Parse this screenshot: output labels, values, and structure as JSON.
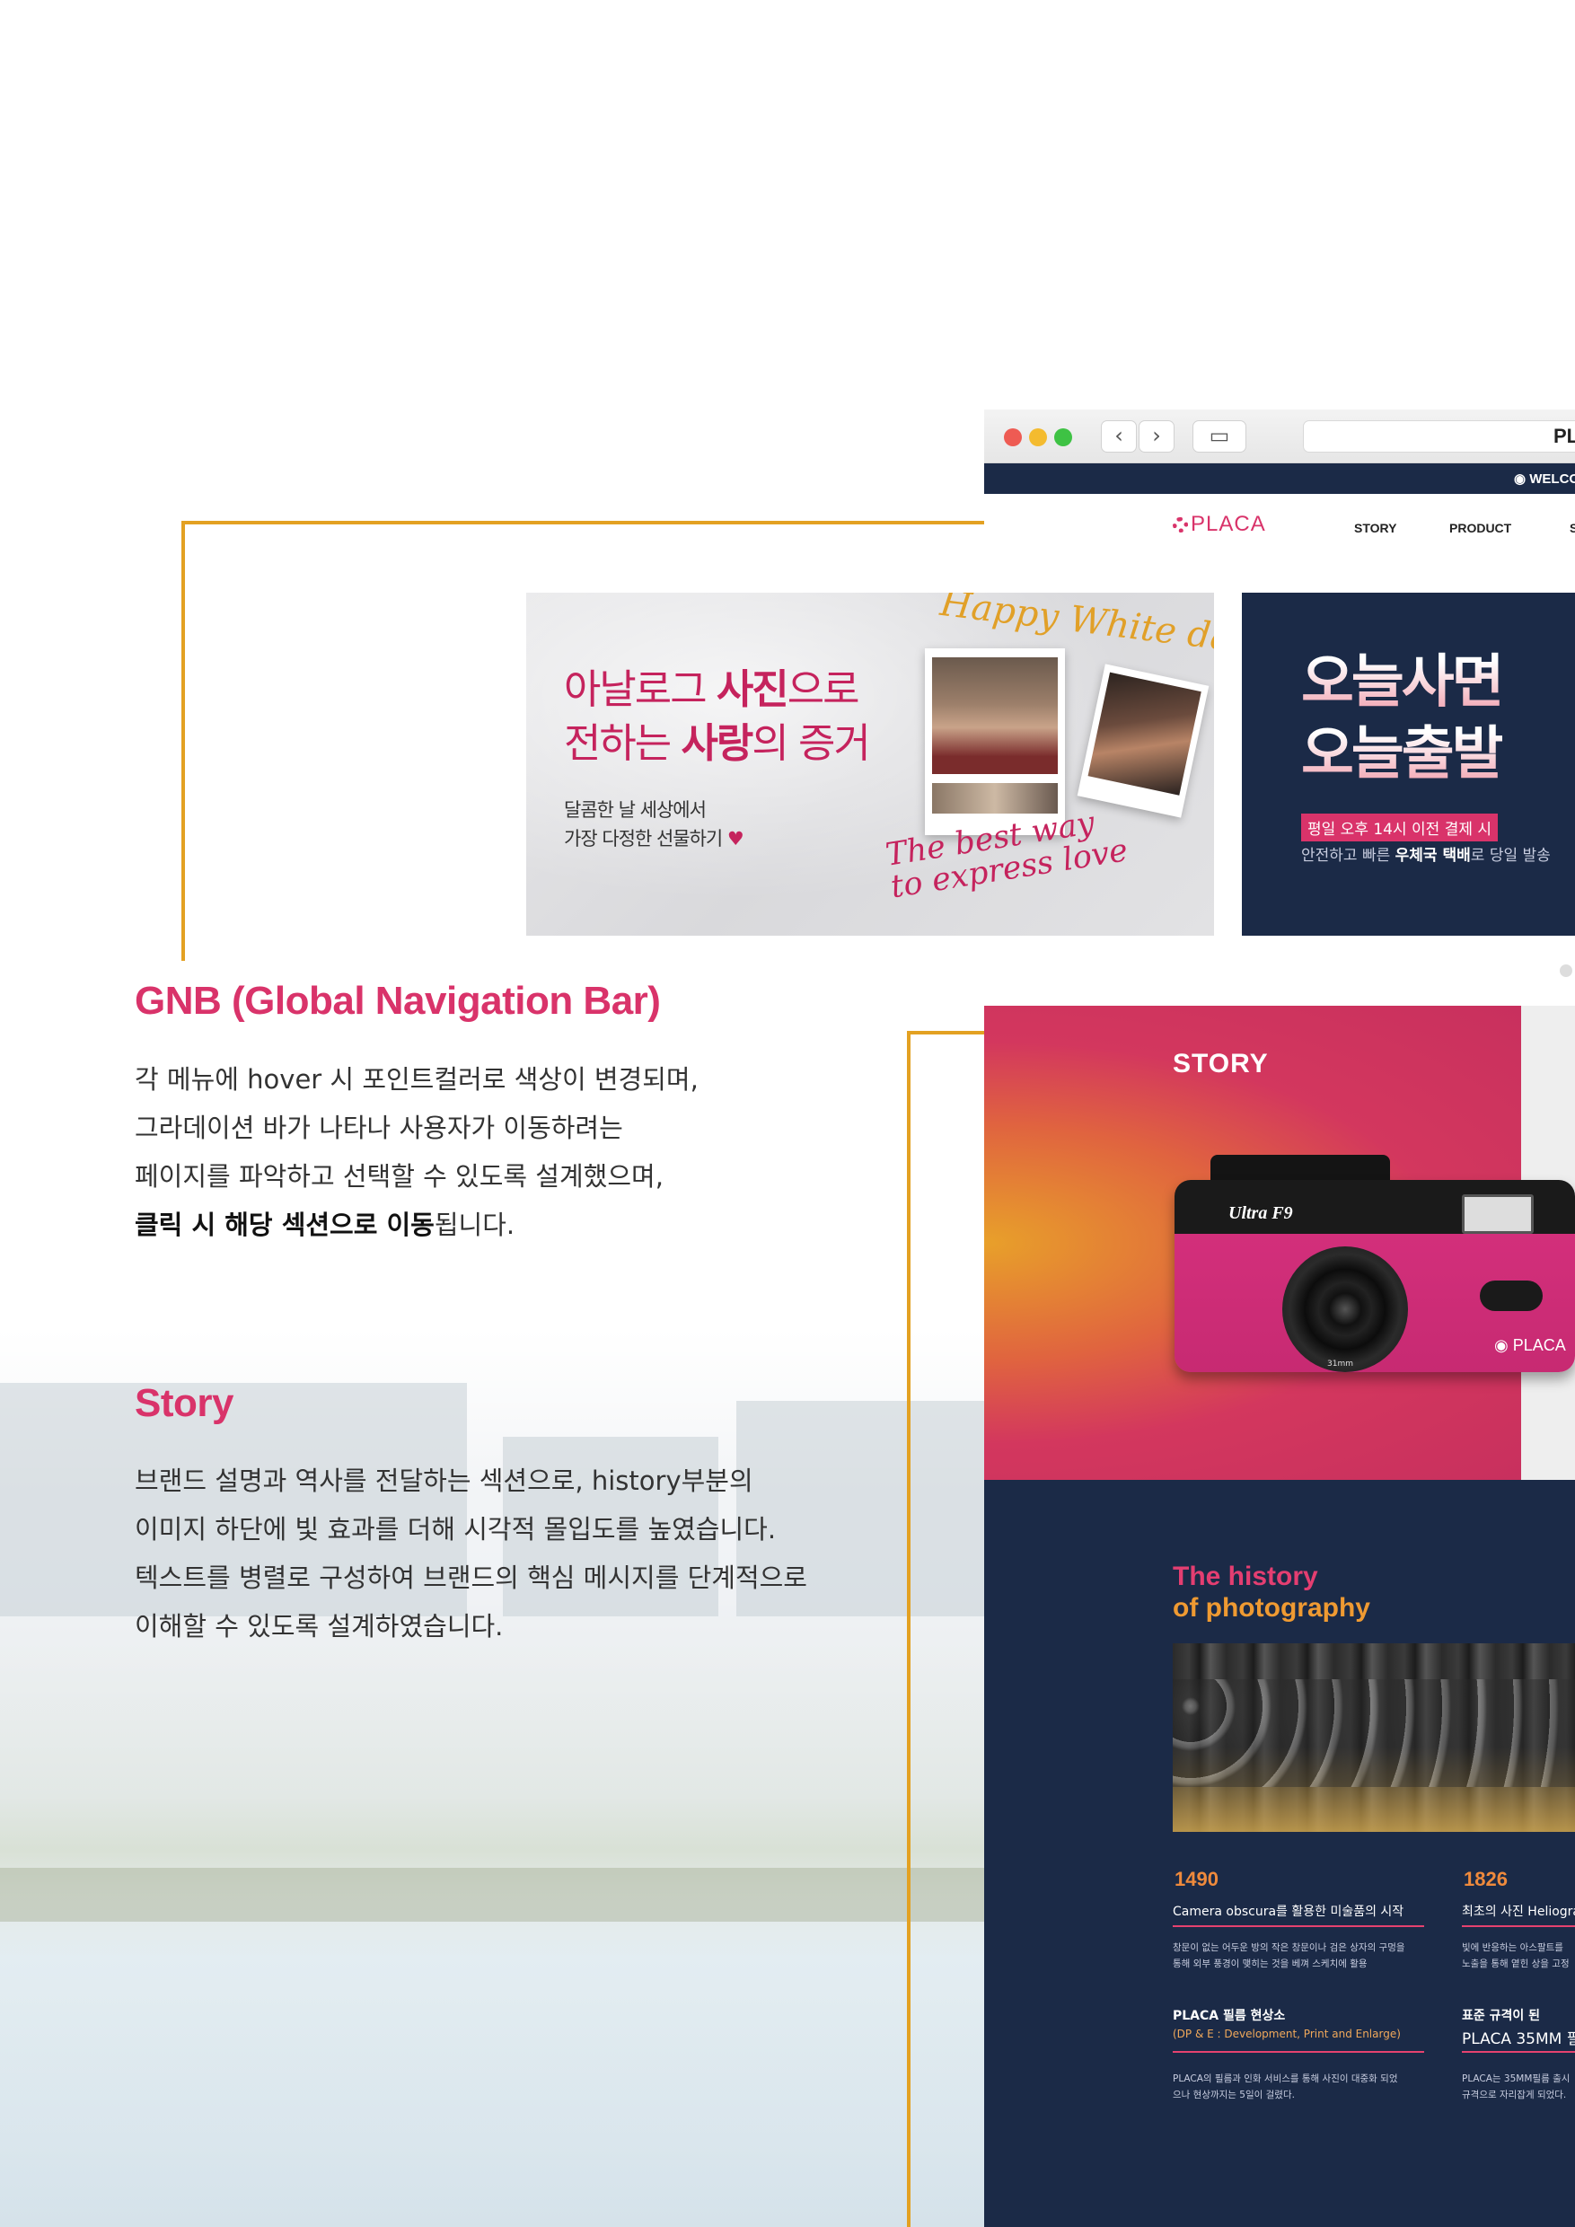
{
  "gnb_section": {
    "title": "GNB (Global Navigation Bar)",
    "lines": [
      "각 메뉴에 hover 시 포인트컬러로 색상이 변경되며,",
      "그라데이션 바가 나타나 사용자가 이동하려는",
      "페이지를 파악하고 선택할 수 있도록 설계했으며,"
    ],
    "last_line_bold": "클릭 시 해당 섹션으로 이동",
    "last_line_rest": "됩니다."
  },
  "story_section": {
    "title": "Story",
    "lines": [
      "브랜드 설명과 역사를 전달하는 섹션으로, history부분의",
      "이미지 하단에 빛 효과를 더해  시각적 몰입도를 높였습니다.",
      "텍스트를 병렬로 구성하여 브랜드의 핵심 메시지를 단계적으로",
      "이해할 수 있도록 설계하였습니다."
    ]
  },
  "browser": {
    "url_text": "PL",
    "back_glyph": "‹",
    "forward_glyph": "›",
    "sidebar_glyph": "▭",
    "traffic_colors": [
      "#ee5b53",
      "#f4bb2f",
      "#3ec244"
    ],
    "welcome_text": "WELCO",
    "logo_text": "PLACA",
    "menu": [
      "STORY",
      "PRODUCT",
      "S"
    ]
  },
  "banner_valentine": {
    "headline_1_pre": "아날로그 ",
    "headline_1_bold": "사진",
    "headline_1_post": "으로",
    "headline_2_pre": "전하는 ",
    "headline_2_bold": "사랑",
    "headline_2_post": "의 증거",
    "sub_1": "달콤한 날 세상에서",
    "sub_2": "가장 다정한 선물하기",
    "heart_glyph": "♥",
    "script_top": "Happy White day",
    "script_bottom_1": "The best way",
    "script_bottom_2": "to express love"
  },
  "banner_delivery": {
    "headline_1": "오늘사면",
    "headline_2": "오늘출발",
    "tag": "평일 오후 14시 이전 결제 시",
    "desc_pre": "안전하고 빠른 ",
    "desc_bold": "우체국 택배",
    "desc_post": "로 당일 발송"
  },
  "story_page": {
    "label": "STORY",
    "camera_model": "Ultra F9",
    "camera_logo": "PLACA",
    "camera_mm": "31mm"
  },
  "history": {
    "title_line1": "The history",
    "title_line2": "of photography",
    "items": [
      {
        "year": "1490",
        "title": "Camera obscura를 활용한 미술품의 시작",
        "desc_1": "창문이 없는 어두운 방의 작은 창문이나 검은 상자의 구멍을",
        "desc_2": "통해 외부 풍경이 맺히는 것을 베껴 스케치에 활용"
      },
      {
        "year": "1826",
        "title": "최초의 사진 Heliogra",
        "desc_1": "빛에 반응하는 아스팔트를",
        "desc_2": "노출을 통해 옅힌 상을 고정"
      },
      {
        "title_bold": "PLACA 필름 현상소",
        "subtitle": "(DP & E : Development, Print and Enlarge)",
        "desc_1": "PLACA의 필름과 인화 서비스를 통해 사진이 대중화 되었",
        "desc_2": "으나 현상까지는 5일이 걸렸다."
      },
      {
        "title_bold": "표준 규격이 된",
        "title_line2": "PLACA 35MM 필",
        "desc_1": "PLACA는 35MM필름 출시",
        "desc_2": "규격으로 자리잡게 되었다."
      }
    ]
  },
  "colors": {
    "accent_pink": "#d9336a",
    "accent_gold": "#e3a122",
    "navy": "#1b2a47"
  }
}
